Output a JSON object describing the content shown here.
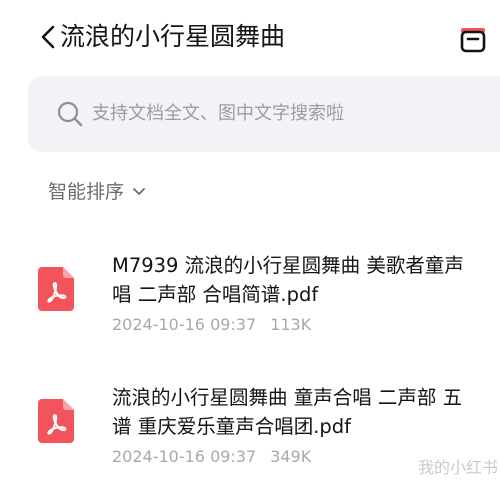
{
  "header": {
    "title": "流浪的小行星圆舞曲",
    "back_icon": "chevron-left-icon",
    "right_icon": "cloud-drive-icon"
  },
  "search": {
    "placeholder": "支持文档全文、图中文字搜索啦",
    "icon": "search-icon"
  },
  "sort": {
    "label": "智能排序",
    "icon": "chevron-down-icon"
  },
  "files": [
    {
      "name_line1": "M7939 流浪的小行星圆舞曲 美歌者童声",
      "name_line2": "唱 二声部 合唱简谱.pdf",
      "date": "2024-10-16 09:37",
      "size": "113K",
      "icon": "pdf-file-icon"
    },
    {
      "name_line1": "流浪的小行星圆舞曲 童声合唱 二声部 五",
      "name_line2": "谱 重庆爱乐童声合唱团.pdf",
      "date": "2024-10-16 09:37",
      "size": "349K",
      "icon": "pdf-file-icon"
    }
  ],
  "watermark": "我的小红书",
  "colors": {
    "pdf_red": "#f2545b",
    "search_bg": "#f2f3f6",
    "meta_text": "#a7a9ae"
  }
}
